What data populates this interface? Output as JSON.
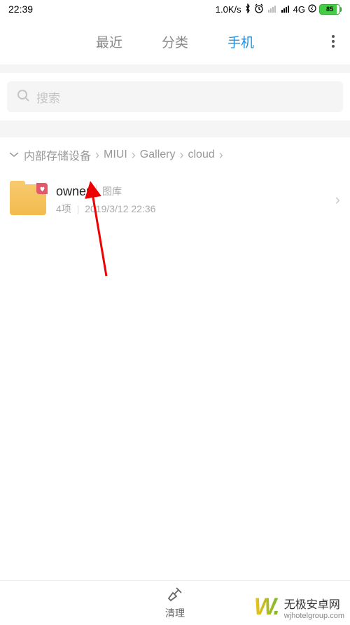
{
  "status": {
    "time": "22:39",
    "speed": "1.0K/s",
    "network": "4G",
    "battery": "85"
  },
  "tabs": {
    "items": [
      "最近",
      "分类",
      "手机"
    ],
    "active_index": 2
  },
  "search": {
    "placeholder": "搜索"
  },
  "breadcrumb": {
    "items": [
      "内部存储设备",
      "MIUI",
      "Gallery",
      "cloud"
    ]
  },
  "folder": {
    "name": "owner",
    "tag": "图库",
    "count_label": "4项",
    "date": "2019/3/12 22:36"
  },
  "bottom": {
    "clean_label": "清理"
  },
  "watermark": {
    "title": "无极安卓网",
    "url": "wjhotelgroup.com"
  }
}
